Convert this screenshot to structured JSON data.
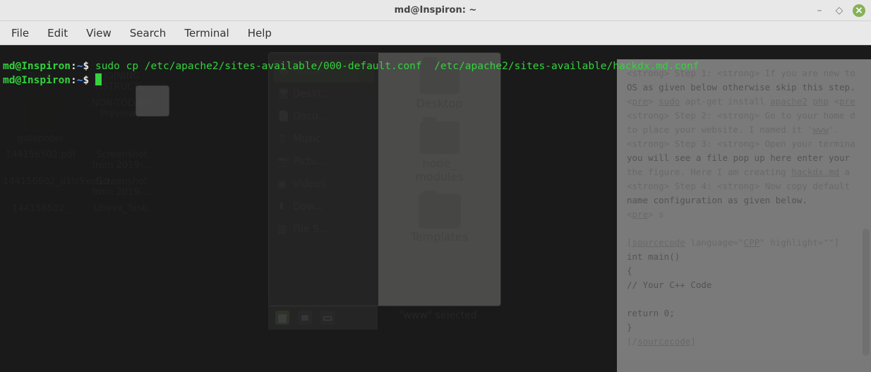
{
  "window": {
    "title": "md@Inspiron: ~"
  },
  "menu": {
    "file": "File",
    "edit": "Edit",
    "view": "View",
    "search": "Search",
    "terminal": "Terminal",
    "help": "Help"
  },
  "prompt": {
    "user": "md@Inspiron",
    "sep": ":",
    "path": "~",
    "end": "$ "
  },
  "command": "sudo cp /etc/apache2/sites-available/000-default.conf  /etc/apache2/sites-available/hackdx.md.conf",
  "desktop": {
    "r0": {
      "a": "Trash",
      "b": "JOINING INSTRUCTI..."
    },
    "r1": {
      "a": "gatenotes",
      "b": "NON-TOD Bill Preview..."
    },
    "r2": {
      "a": "144156502.pdf",
      "b": "Screenshot from 2019-..."
    },
    "r3": {
      "a": "144156502_d1lz5xoi1d..",
      "b": "Screenshot from 2019-..."
    },
    "r4": {
      "a": "144156502_",
      "b": "Uneva_Task."
    }
  },
  "fm": {
    "places": {
      "home": "Home",
      "desktop": "Deskt...",
      "documents": "Docu...",
      "music": "Music",
      "pictures": "Pictu...",
      "videos": "Videos",
      "downloads": "Dow...",
      "filesystem": "File S..."
    },
    "items": {
      "desktop": "Desktop",
      "node": "node_\nmodules",
      "templates": "Templates"
    },
    "status": "\"www\" selected"
  },
  "doc": {
    "l1a": "<strong>",
    "l1b": " Step 1: ",
    "l1c": "<strong>",
    "l1d": " If you are new to",
    "l2": "OS as given below otherwise skip this step.",
    "l3a": "<",
    "l3b": "pre",
    "l3c": "> ",
    "l3d": "sudo",
    "l3e": " apt-get install ",
    "l3f": "apache2",
    "l3g": " ",
    "l3h": "php",
    "l3i": " <",
    "l3j": "pre",
    "l4a": "<strong>",
    "l4b": " Step 2: ",
    "l4c": "<strong>",
    "l4d": " Go to your home d",
    "l5": "to place your website. I named it '",
    "l5b": "www",
    "l5c": "'.",
    "l6a": "<strong>",
    "l6b": " Step 3: ",
    "l6c": "<strong>",
    "l6d": " Open your termina",
    "l7": "you will see a file pop up here enter your ",
    "l8a": "the figure. Here  I am creating ",
    "l8b": "hackdx.md",
    "l8c": " a",
    "l9a": "<strong>",
    "l9b": " Step 4: ",
    "l9c": "<strong>",
    "l9d": " Now copy default ",
    "l10": "name configuration as given below.",
    "l11a": "<",
    "l11b": "pre",
    "l11c": "> s",
    "l13a": "[",
    "l13b": "sourcecode",
    "l13c": " language=\"",
    "l13d": "CPP",
    "l13e": "\" highlight=\"\"]",
    "l14": "int main()",
    "l15": "{",
    "l16": "  // Your C++ Code",
    "l17": "  return 0;",
    "l18": "}",
    "l19a": "[/",
    "l19b": "sourcecode",
    "l19c": "]"
  }
}
